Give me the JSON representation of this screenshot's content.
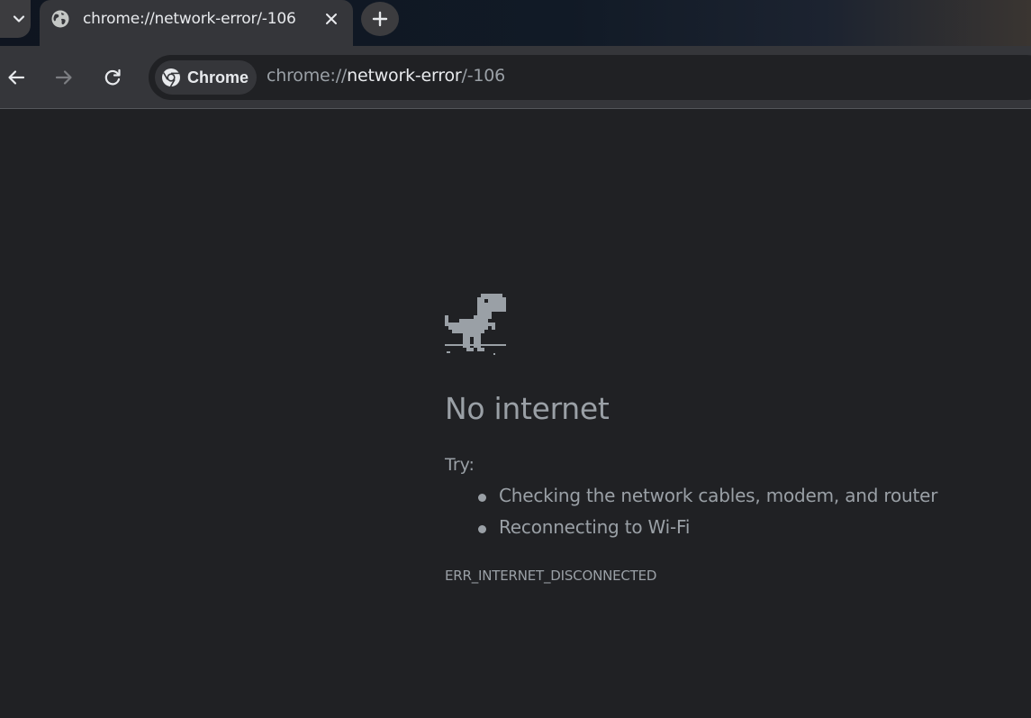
{
  "tab": {
    "title": "chrome://network-error/-106",
    "favicon": "globe-icon"
  },
  "omnibox": {
    "chip_label": "Chrome",
    "url_scheme": "chrome://",
    "url_host": "network-error",
    "url_path": "/-106"
  },
  "error": {
    "illustration": "dinosaur-icon",
    "title": "No internet",
    "try_label": "Try:",
    "suggestions": [
      "Checking the network cables, modem, and router",
      "Reconnecting to Wi-Fi"
    ],
    "code": "ERR_INTERNET_DISCONNECTED"
  },
  "colors": {
    "page_background": "#202124",
    "toolbar_background": "#35363a",
    "text_primary": "#e8eaed",
    "text_secondary": "#9aa0a6"
  }
}
